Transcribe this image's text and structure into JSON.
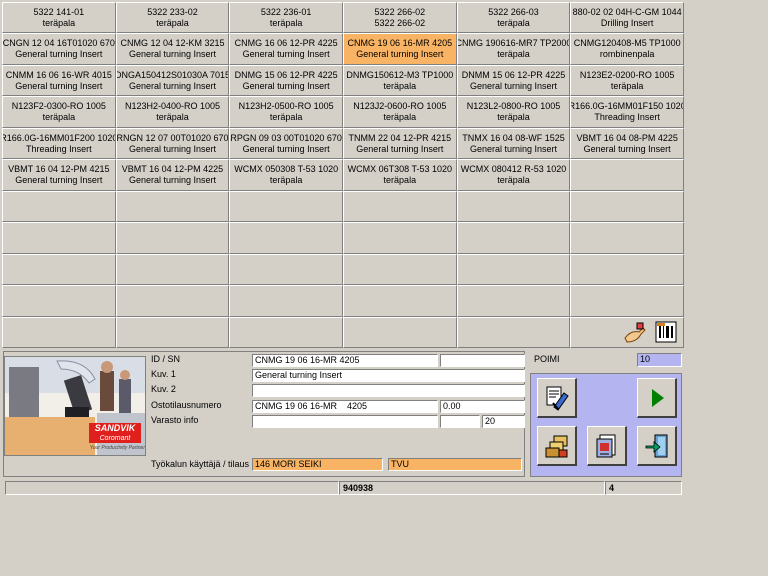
{
  "grid": {
    "rows": [
      [
        {
          "l1": "5322 141-01",
          "l2": "teräpala"
        },
        {
          "l1": "5322 233-02",
          "l2": "teräpala"
        },
        {
          "l1": "5322 236-01",
          "l2": "teräpala"
        },
        {
          "l1": "5322 266-02",
          "l2": "5322 266-02"
        },
        {
          "l1": "5322 266-03",
          "l2": "teräpala"
        },
        {
          "l1": "880-02 02 04H-C-GM 1044",
          "l2": "Drilling Insert"
        }
      ],
      [
        {
          "l1": "CNGN 12 04 16T01020 670",
          "l2": "General turning Insert"
        },
        {
          "l1": "CNMG 12 04 12-KM 3215",
          "l2": "General turning Insert"
        },
        {
          "l1": "CNMG 16 06 12-PR 4225",
          "l2": "General turning Insert"
        },
        {
          "l1": "CNMG 19 06 16-MR 4205",
          "l2": "General turning Insert",
          "selected": true
        },
        {
          "l1": "CNMG 190616-MR7 TP2000",
          "l2": "teräpala"
        },
        {
          "l1": "CNMG120408-M5 TP1000",
          "l2": "rombinenpala"
        }
      ],
      [
        {
          "l1": "CNMM 16 06 16-WR 4015",
          "l2": "General turning Insert"
        },
        {
          "l1": "DNGA150412S01030A 7015",
          "l2": "General turning Insert"
        },
        {
          "l1": "DNMG 15 06 12-PR 4225",
          "l2": "General turning Insert"
        },
        {
          "l1": "DNMG150612-M3 TP1000",
          "l2": "teräpala"
        },
        {
          "l1": "DNMM 15 06 12-PR 4225",
          "l2": "General turning Insert"
        },
        {
          "l1": "N123E2-0200-RO 1005",
          "l2": "teräpala"
        }
      ],
      [
        {
          "l1": "N123F2-0300-RO 1005",
          "l2": "teräpala"
        },
        {
          "l1": "N123H2-0400-RO 1005",
          "l2": "teräpala"
        },
        {
          "l1": "N123H2-0500-RO 1005",
          "l2": "teräpala"
        },
        {
          "l1": "N123J2-0600-RO 1005",
          "l2": "teräpala"
        },
        {
          "l1": "N123L2-0800-RO 1005",
          "l2": "teräpala"
        },
        {
          "l1": "R166.0G-16MM01F150 1020",
          "l2": "Threading Insert"
        }
      ],
      [
        {
          "l1": "R166.0G-16MM01F200 1020",
          "l2": "Threading Insert"
        },
        {
          "l1": "RNGN 12 07 00T01020 670",
          "l2": "General turning Insert"
        },
        {
          "l1": "RPGN 09 03 00T01020 670",
          "l2": "General turning Insert"
        },
        {
          "l1": "TNMM 22 04 12-PR 4215",
          "l2": "General turning Insert"
        },
        {
          "l1": "TNMX 16 04 08-WF 1525",
          "l2": "General turning Insert"
        },
        {
          "l1": "VBMT 16 04 08-PM 4225",
          "l2": "General turning Insert"
        }
      ],
      [
        {
          "l1": "VBMT 16 04 12-PM 4215",
          "l2": "General turning Insert"
        },
        {
          "l1": "VBMT 16 04 12-PM 4225",
          "l2": "General turning Insert"
        },
        {
          "l1": "WCMX 050308 T-53 1020",
          "l2": "teräpala"
        },
        {
          "l1": "WCMX 06T308 T-53 1020",
          "l2": "teräpala"
        },
        {
          "l1": "WCMX 080412 R-53 1020",
          "l2": "teräpala"
        },
        {
          "l1": "",
          "l2": ""
        }
      ]
    ],
    "empty_rows": 5,
    "corner_icons": [
      "pick-hand-icon",
      "barcode-reader-icon"
    ]
  },
  "info": {
    "labels": {
      "id_sn": "ID / SN",
      "kuv1": "Kuv. 1",
      "kuv2": "Kuv. 2",
      "ostotilausnumero": "Ostotilausnumero",
      "varasto_info": "Varasto info",
      "tyokalun": "Työkalun käyttäjä / tilaus"
    },
    "values": {
      "id_sn": "CNMG 19 06 16-MR 4205",
      "id_sn_2": "",
      "kuv1": "General turning Insert",
      "kuv2": "",
      "ostotilausnumero": "CNMG 19 06 16-MR    4205",
      "ostotilaus_price": "0.00",
      "varasto_info": "",
      "varasto_2": "",
      "varasto_qty": "20",
      "user": "146 MORI SEIKI",
      "order": "TVU"
    },
    "logo_text": "SANDVIK",
    "logo_sub": "Coromant",
    "logo_tagline": "Your Productivity Partner"
  },
  "poimi": {
    "label": "POIMI",
    "value": "10"
  },
  "actions": {
    "icons": [
      "edit-tool-icon",
      "play-icon",
      "tool-stack-icon",
      "report-icon",
      "exit-door-icon"
    ]
  },
  "statusbar": {
    "left": "",
    "middle": "940938",
    "right": "4"
  },
  "colors": {
    "background": "#d4d0c8",
    "selected": "#f8b464",
    "action_panel": "#b4b4f0",
    "play": "#008000"
  }
}
